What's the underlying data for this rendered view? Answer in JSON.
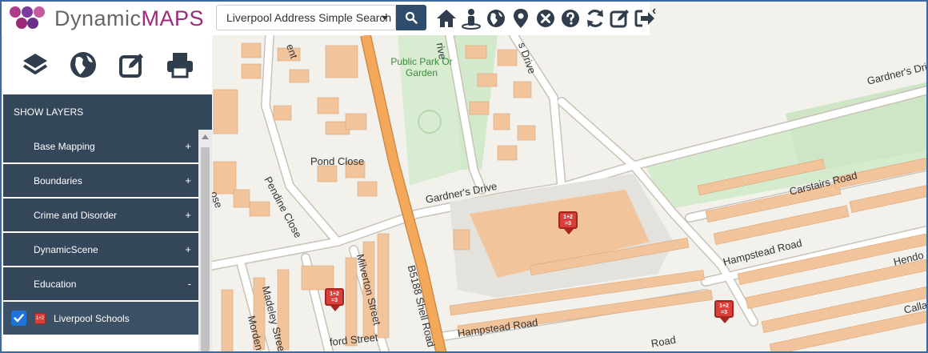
{
  "app": {
    "logo_prefix": "Dynamic",
    "logo_suffix": "MAPS"
  },
  "search": {
    "selected": "Liverpool Address Simple Search"
  },
  "toolbar": {
    "icons": [
      "home-icon",
      "person-info-icon",
      "globe-icon",
      "map-marker-icon",
      "clear-icon",
      "help-icon",
      "refresh-icon",
      "edit-icon",
      "sign-out-icon"
    ],
    "collapse_glyph": "‹"
  },
  "sidebar": {
    "icons": [
      "layers-icon",
      "globe-icon",
      "edit-icon",
      "print-icon"
    ],
    "show_layers_label": "SHOW LAYERS",
    "layers": [
      {
        "label": "Base Mapping",
        "toggle": "+"
      },
      {
        "label": "Boundaries",
        "toggle": "+"
      },
      {
        "label": "Crime and Disorder",
        "toggle": "+"
      },
      {
        "label": "DynamicScene",
        "toggle": "+"
      },
      {
        "label": "Education",
        "toggle": "-"
      }
    ],
    "sublayer": {
      "label": "Liverpool Schools",
      "checked": true
    }
  },
  "map": {
    "labels": {
      "park": "Public Park Or Garden",
      "gardners_drive_1": "Gardner's Drive",
      "gardners_drive_2": "Gardner's Dri",
      "pond_close": "Pond Close",
      "pendine_close": "Pendine Close",
      "milverton_street": "Milverton Street",
      "madeley_street": "Madeley Street",
      "morden": "Morden",
      "shell_road": "B5188 Shell Road",
      "hampstead_road_1": "Hampstead Road",
      "hampstead_road_2": "Hampstead Road",
      "carstairs_road": "Carstairs Road",
      "hendo": "Hendo",
      "calla": "Calla",
      "oxford_street": "ford Street",
      "road_bottom": "Road",
      "ent": "ent",
      "ose": "ose",
      "drive_top": "s Drive",
      "rive": "rive"
    },
    "marker_text": "1+2 =3",
    "colors": {
      "building": "#f2c49b",
      "road": "#ffffff",
      "main_road": "#f4a95a",
      "park": "#cfe8c8",
      "background": "#f3f1ec"
    }
  }
}
